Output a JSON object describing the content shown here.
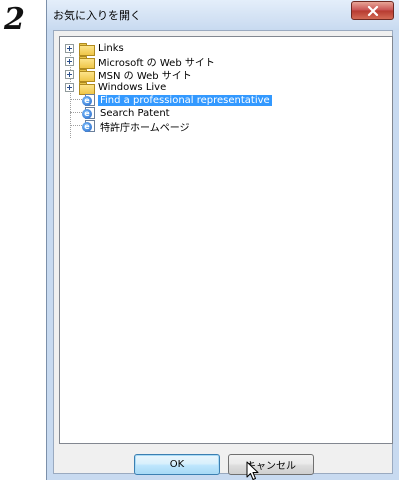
{
  "step": {
    "number": "2"
  },
  "window": {
    "title": "お気に入りを開く"
  },
  "tree": {
    "items": [
      {
        "label": "Links",
        "type": "folder",
        "expandable": true
      },
      {
        "label": "Microsoft の Web サイト",
        "type": "folder",
        "expandable": true
      },
      {
        "label": "MSN の Web サイト",
        "type": "folder",
        "expandable": true
      },
      {
        "label": "Windows Live",
        "type": "folder",
        "expandable": true
      },
      {
        "label": "Find a professional representative",
        "type": "link",
        "selected": true
      },
      {
        "label": "Search Patent",
        "type": "link"
      },
      {
        "label": "特許庁ホームページ",
        "type": "link"
      }
    ]
  },
  "buttons": {
    "ok": "OK",
    "cancel": "キャンセル"
  },
  "colors": {
    "selection": "#3399ff",
    "close_button": "#c75050",
    "frame": "#c8daf0"
  },
  "icons": [
    "close-icon",
    "folder-icon",
    "ie-page-icon",
    "expand-plus-icon",
    "mouse-pointer-icon"
  ]
}
